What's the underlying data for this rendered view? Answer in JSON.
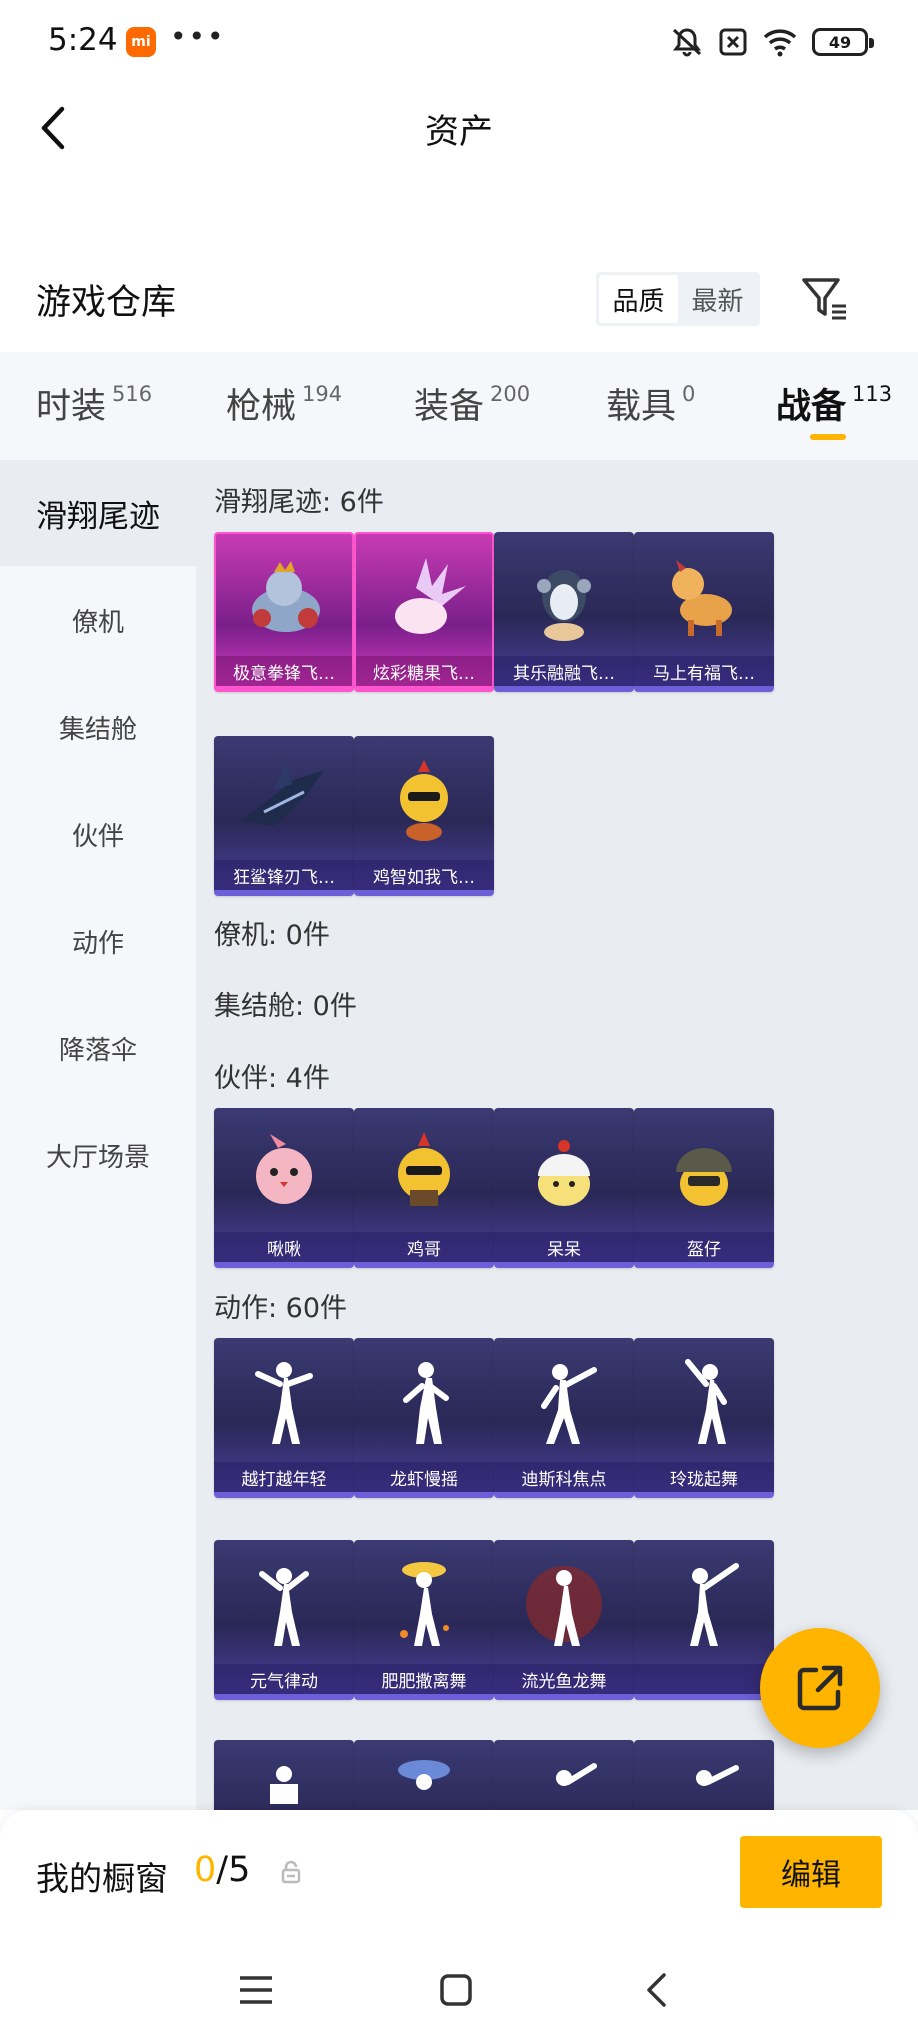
{
  "status": {
    "time": "5:24",
    "app_badge": "mi",
    "more": "•••",
    "battery": "49"
  },
  "header": {
    "title": "资产"
  },
  "warehouse": {
    "title": "游戏仓库",
    "sort_quality": "品质",
    "sort_newest": "最新"
  },
  "tabs": [
    {
      "label": "时装",
      "count": "516"
    },
    {
      "label": "枪械",
      "count": "194"
    },
    {
      "label": "装备",
      "count": "200"
    },
    {
      "label": "载具",
      "count": "0"
    },
    {
      "label": "战备",
      "count": "113"
    }
  ],
  "side_menu": [
    "滑翔尾迹",
    "僚机",
    "集结舱",
    "伙伴",
    "动作",
    "降落伞",
    "大厅场景"
  ],
  "sections": {
    "glide": {
      "title": "滑翔尾迹: 6件",
      "items": [
        "极意拳锋飞…",
        "炫彩糖果飞…",
        "其乐融融飞…",
        "马上有福飞…",
        "狂鲨锋刃飞…",
        "鸡智如我飞…"
      ]
    },
    "wingman": {
      "title": "僚机: 0件"
    },
    "capsule": {
      "title": "集结舱: 0件"
    },
    "partner": {
      "title": "伙伴: 4件",
      "items": [
        "啾啾",
        "鸡哥",
        "呆呆",
        "盔仔"
      ]
    },
    "emote": {
      "title": "动作: 60件",
      "items": [
        "越打越年轻",
        "龙虾慢摇",
        "迪斯科焦点",
        "玲珑起舞",
        "元气律动",
        "肥肥撒离舞",
        "流光鱼龙舞",
        ""
      ]
    }
  },
  "showcase": {
    "title": "我的橱窗",
    "current": "0",
    "total": "/5",
    "edit_label": "编辑"
  },
  "colors": {
    "accent": "#ffb400",
    "card_purple": "#2a2856",
    "card_pink": "#c83bb4"
  }
}
